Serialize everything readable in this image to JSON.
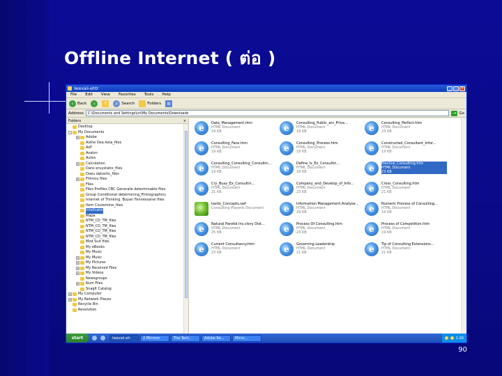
{
  "slide": {
    "title": "Offline Internet ( ต่อ )",
    "page_number": "90"
  },
  "window": {
    "title": "Ιwevaii-ehtr",
    "menu": [
      "File",
      "Edit",
      "View",
      "Favorites",
      "Tools",
      "Help"
    ],
    "toolbar": {
      "back": "Back",
      "forward": "",
      "up": "",
      "search": "Search",
      "folders": "Folders"
    },
    "address_label": "Address",
    "address_value": "C:\\Documents and Settings\\ict\\My Documents\\Downloads",
    "go_label": "Go",
    "folders_pane_title": "Folders",
    "tree": [
      {
        "label": "Desktop",
        "exp": ""
      },
      {
        "label": "My Documents",
        "exp": "-"
      },
      {
        "label": "Adobe",
        "exp": "+"
      },
      {
        "label": "Asthe Dea Asta_files",
        "exp": ""
      },
      {
        "label": "AsP",
        "exp": ""
      },
      {
        "label": "Avalon",
        "exp": ""
      },
      {
        "label": "Autos",
        "exp": ""
      },
      {
        "label": "Calculation",
        "exp": "+"
      },
      {
        "label": "Dans eruystatio_files",
        "exp": ""
      },
      {
        "label": "Doeu datostiu_files",
        "exp": ""
      },
      {
        "label": "Fhlmou files",
        "exp": "+"
      },
      {
        "label": "Files",
        "exp": ""
      },
      {
        "label": "Files Profiles CBC Generate determinable files",
        "exp": ""
      },
      {
        "label": "Group Conditional determining_Firmographics",
        "exp": ""
      },
      {
        "label": "Internet of Thinking. Buyan Fennessanel files",
        "exp": ""
      },
      {
        "label": "Item Coutomine_tiles",
        "exp": ""
      },
      {
        "label": "Intelicator",
        "exp": "",
        "selected": true
      },
      {
        "label": "Mapa",
        "exp": ""
      },
      {
        "label": "NTM_CD_TM_files",
        "exp": ""
      },
      {
        "label": "NTM_CD_TM_files",
        "exp": ""
      },
      {
        "label": "NTM_CD_TM_files",
        "exp": ""
      },
      {
        "label": "NTM_CD_TM_files",
        "exp": ""
      },
      {
        "label": "Mod Suit files",
        "exp": ""
      },
      {
        "label": "My eBooks",
        "exp": ""
      },
      {
        "label": "My Music",
        "exp": ""
      },
      {
        "label": "My Music",
        "exp": "+"
      },
      {
        "label": "My Pictures",
        "exp": "+"
      },
      {
        "label": "My Received Files",
        "exp": "+"
      },
      {
        "label": "My Videos",
        "exp": "+"
      },
      {
        "label": "Newsgroups",
        "exp": ""
      },
      {
        "label": "Num Files",
        "exp": "+"
      },
      {
        "label": "SnagIt Catalog",
        "exp": ""
      },
      {
        "label": "My Computer",
        "exp": "+"
      },
      {
        "label": "My Network Places",
        "exp": "+"
      },
      {
        "label": "Recycle Bin",
        "exp": ""
      },
      {
        "label": "Revolution",
        "exp": ""
      }
    ],
    "files": [
      {
        "name": "Data_Management.htm",
        "type": "HTML Document",
        "size": "24 KB"
      },
      {
        "name": "Consulting_Public_ani_Priva...",
        "type": "HTML Document",
        "size": "18 KB"
      },
      {
        "name": "Consulting_Perfect.htm",
        "type": "HTML Document",
        "size": "23 KB"
      },
      {
        "name": "Consulting_Face.htm",
        "type": "HTML Document",
        "size": "19 KB"
      },
      {
        "name": "Consulting_Process.htm",
        "type": "HTML Document",
        "size": "18 KB"
      },
      {
        "name": "Constructed_Consultant_Infor...",
        "type": "HTML Document",
        "size": "19 KB"
      },
      {
        "name": "Consulting_Consulting_Consultin...",
        "type": "HTML Document",
        "size": "19 KB"
      },
      {
        "name": "Define_Is_Ex_Consultin...",
        "type": "HTML Document",
        "size": "18 KB"
      },
      {
        "name": "Elective_Consulting.htm",
        "type": "HTML Document",
        "size": "23 KB",
        "selected": true
      },
      {
        "name": "Cry_Busy_Ex_Consultin...",
        "type": "HTML Document",
        "size": "21 KB"
      },
      {
        "name": "Company_and_Develop_of_Info...",
        "type": "HTML Document",
        "size": "23 KB"
      },
      {
        "name": "Cross_Consulting.htm",
        "type": "HTML Document",
        "size": "21 KB"
      },
      {
        "name": "tastlo_Concepts.swf",
        "type": "Consulting Playeris Document",
        "size": "",
        "green": true
      },
      {
        "name": "Information Management Analyse...",
        "type": "HTML Document",
        "size": "29 KB"
      },
      {
        "name": "Numeric Process of Consulting...",
        "type": "HTML Document",
        "size": "19 KB"
      },
      {
        "name": "Natural Parotid Ins.ctory Dist...",
        "type": "HTML Document",
        "size": "25 KB"
      },
      {
        "name": "Process Of Consulting.htm",
        "type": "HTML Document",
        "size": "23 KB"
      },
      {
        "name": "Process of Competition.htm",
        "type": "HTML Document",
        "size": "19 KB"
      },
      {
        "name": "Current Consultancy.htm",
        "type": "HTML Document",
        "size": "23 KB"
      },
      {
        "name": "Governing Leadership",
        "type": "HTML Document",
        "size": "21 KB"
      },
      {
        "name": "Tip of Consulting Extensions...",
        "type": "HTML Document",
        "size": "21 KB"
      }
    ],
    "taskbar": {
      "start": "start",
      "tasks": [
        "Ιwevaii-eh",
        "2 Microso",
        "The Tech...",
        "Adobe Re...",
        "Micro..."
      ],
      "tray_time": "1:20"
    }
  }
}
